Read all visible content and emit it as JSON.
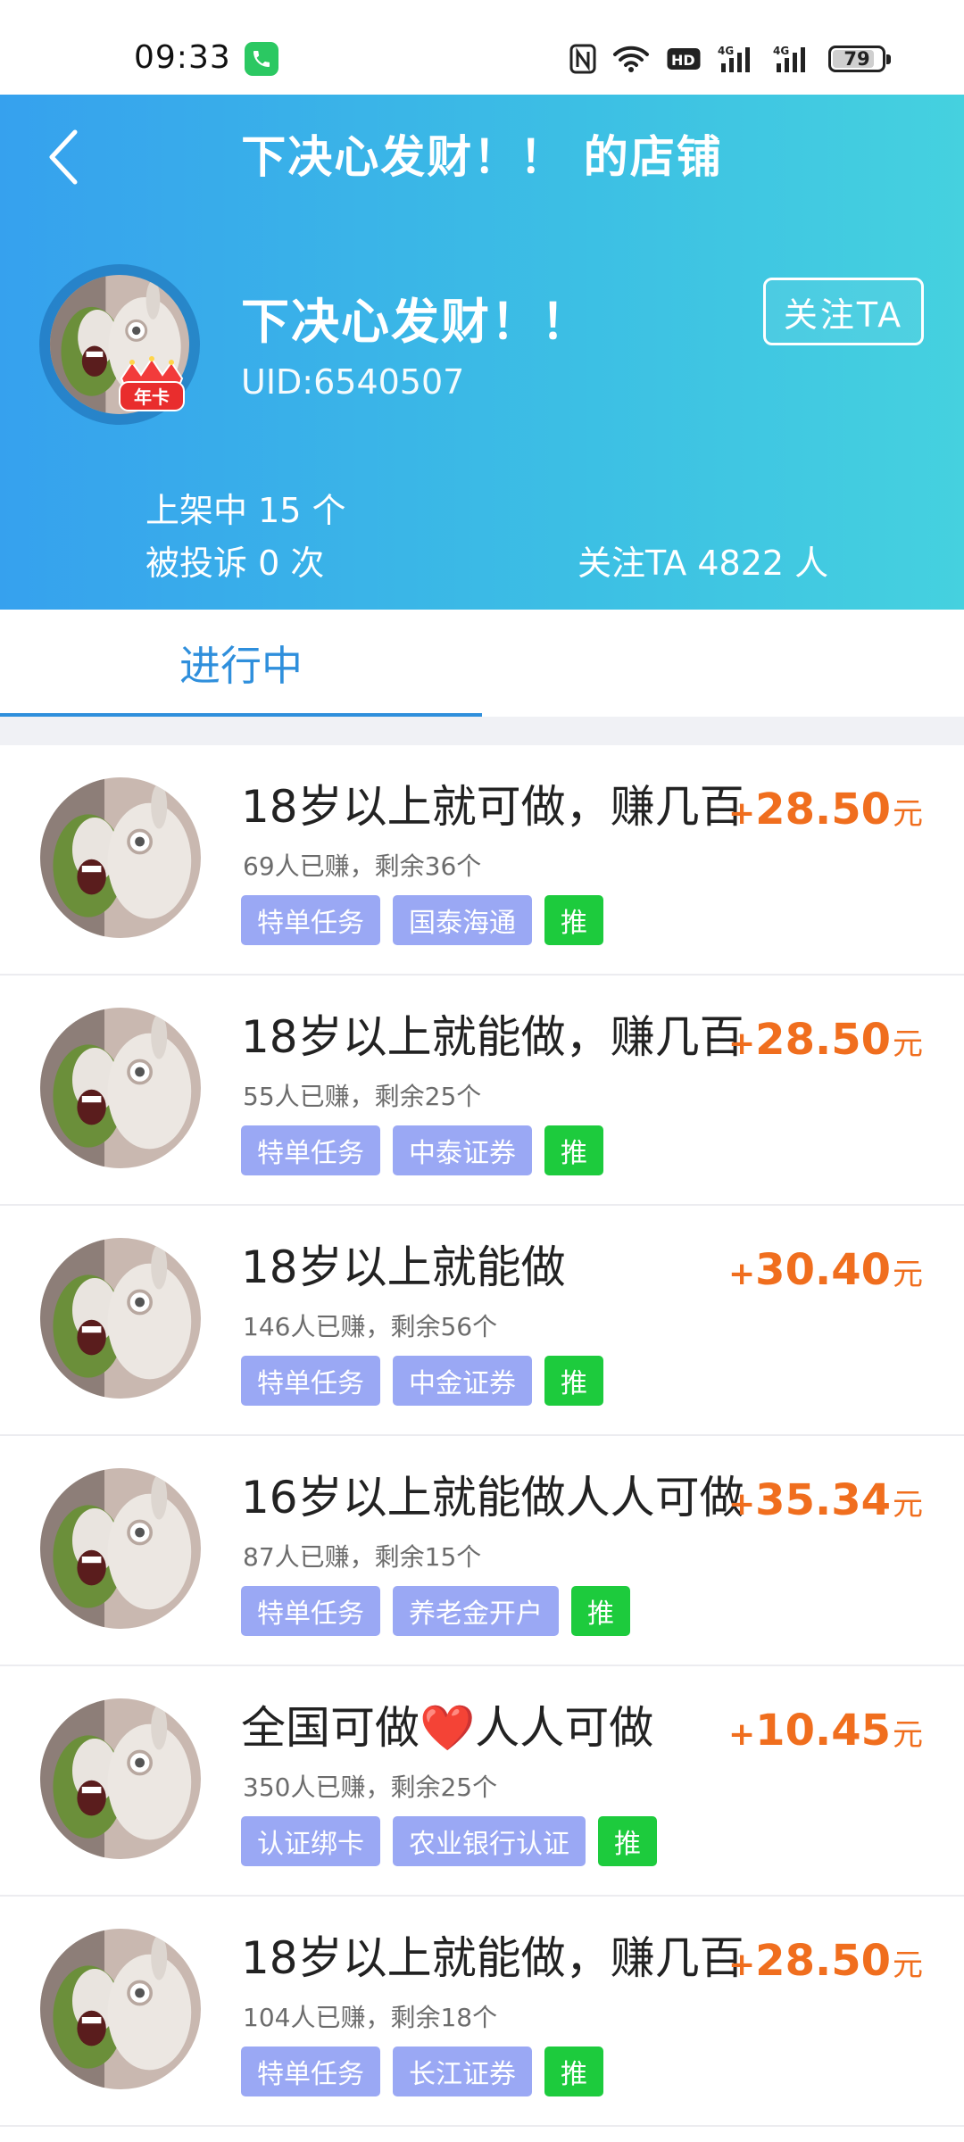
{
  "status_bar": {
    "time": "09:33",
    "battery": "79",
    "battery_level_percent": 79,
    "icons": [
      "phone-call-icon",
      "nfc-icon",
      "wifi-icon",
      "hd-icon",
      "signal-4g-icon",
      "signal-4g-icon",
      "battery-icon"
    ]
  },
  "header": {
    "title": "下决心发财！！ 的店铺",
    "shop_name": "下决心发财！！",
    "uid": "UID:6540507",
    "badge": "年卡",
    "follow_button": "关注TA",
    "listed": "上架中 15 个",
    "complaints": "被投诉 0 次",
    "followers": "关注TA 4822 人"
  },
  "tabs": [
    {
      "label": "进行中",
      "active": true
    }
  ],
  "tasks": [
    {
      "title": "18岁以上就可做，赚几百",
      "meta": "69人已赚，剩余36个",
      "tags": [
        "特单任务",
        "国泰海通"
      ],
      "recommend": "推",
      "reward_plus": "+",
      "reward": "28.50",
      "unit": "元"
    },
    {
      "title": "18岁以上就能做，赚几百",
      "meta": "55人已赚，剩余25个",
      "tags": [
        "特单任务",
        "中泰证券"
      ],
      "recommend": "推",
      "reward_plus": "+",
      "reward": "28.50",
      "unit": "元"
    },
    {
      "title": "18岁以上就能做",
      "meta": "146人已赚，剩余56个",
      "tags": [
        "特单任务",
        "中金证券"
      ],
      "recommend": "推",
      "reward_plus": "+",
      "reward": "30.40",
      "unit": "元"
    },
    {
      "title": "16岁以上就能做人人可做",
      "meta": "87人已赚，剩余15个",
      "tags": [
        "特单任务",
        "养老金开户"
      ],
      "recommend": "推",
      "reward_plus": "+",
      "reward": "35.34",
      "unit": "元"
    },
    {
      "title": "全国可做❤️人人可做",
      "meta": "350人已赚，剩余25个",
      "tags": [
        "认证绑卡",
        "农业银行认证"
      ],
      "recommend": "推",
      "reward_plus": "+",
      "reward": "10.45",
      "unit": "元"
    },
    {
      "title": "18岁以上就能做，赚几百",
      "meta": "104人已赚，剩余18个",
      "tags": [
        "特单任务",
        "长江证券"
      ],
      "recommend": "推",
      "reward_plus": "+",
      "reward": "28.50",
      "unit": "元"
    }
  ]
}
